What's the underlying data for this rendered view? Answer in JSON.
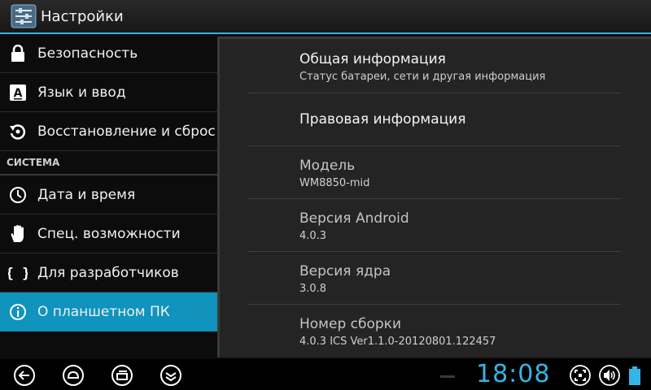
{
  "actionbar": {
    "title": "Настройки"
  },
  "sidebar": {
    "items_top": [
      {
        "label": "Безопасность",
        "icon": "lock-icon"
      },
      {
        "label": "Язык и ввод",
        "icon": "keyboard-a-icon"
      },
      {
        "label": "Восстановление и сброс",
        "icon": "restore-icon"
      }
    ],
    "section_header": "СИСТЕМА",
    "items_system": [
      {
        "label": "Дата и время",
        "icon": "clock-icon"
      },
      {
        "label": "Спец. возможности",
        "icon": "hand-icon"
      },
      {
        "label": "Для разработчиков",
        "icon": "braces-icon"
      },
      {
        "label": "О планшетном ПК",
        "icon": "info-icon",
        "active": true
      }
    ]
  },
  "detail": {
    "items": [
      {
        "title": "Общая информация",
        "summary": "Статус батареи, сети и другая информация"
      },
      {
        "title": "Правовая информация"
      },
      {
        "title": "Модель",
        "summary": "WM8850-mid"
      },
      {
        "title": "Версия Android",
        "summary": "4.0.3"
      },
      {
        "title": "Версия ядра",
        "summary": "3.0.8"
      },
      {
        "title": "Номер сборки",
        "summary": "4.0.3 ICS Ver1.1.0-20120801.122457"
      }
    ]
  },
  "systembar": {
    "clock": "18:08",
    "nav": [
      "back-icon",
      "home-icon",
      "recents-icon",
      "menu-icon"
    ],
    "status_icons": [
      "screenshot-icon",
      "volume-icon",
      "battery-icon"
    ]
  },
  "colors": {
    "accent": "#33b5e5",
    "active_item": "#1093bd"
  }
}
